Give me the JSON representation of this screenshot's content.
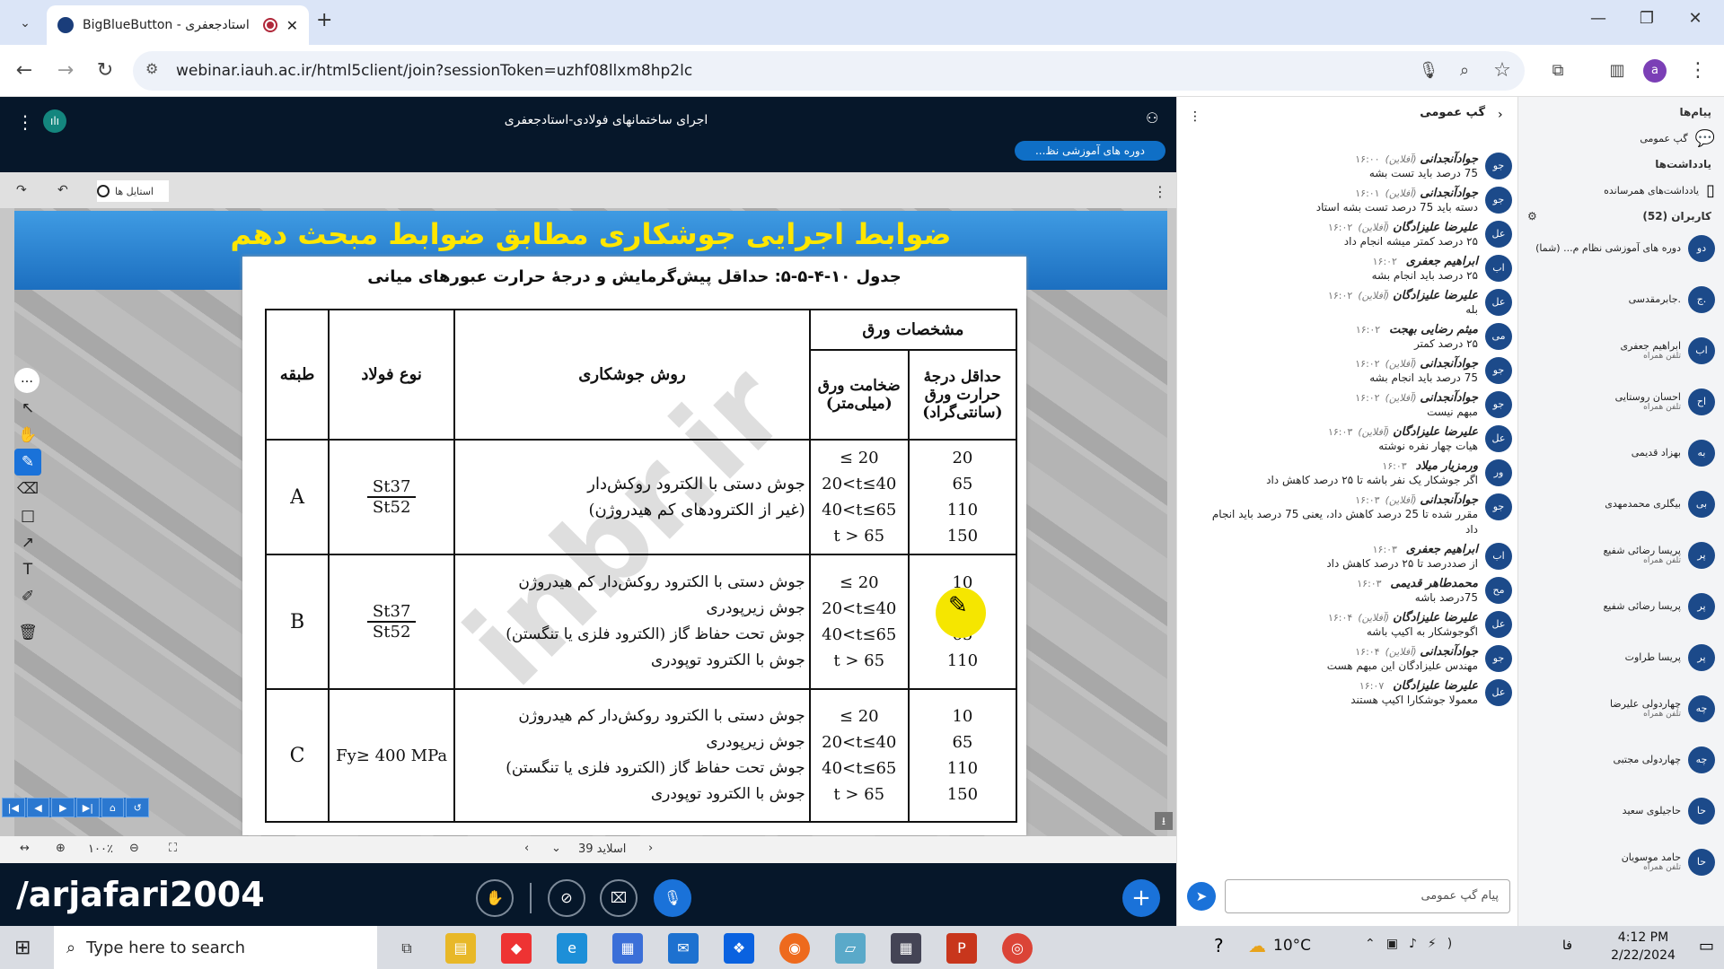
{
  "browser": {
    "tab_title": "BigBlueButton - استادجعفری",
    "url": "webinar.iauh.ac.ir/html5client/join?sessionToken=uzhf08llxm8hp2lc",
    "profile_initial": "a"
  },
  "app": {
    "title": "اجرای ساختمانهای فولادی-استادجعفری",
    "course_badge": "دوره های آموزشی نظ...",
    "styles_label": "استایل ها"
  },
  "slide": {
    "banner": "ضوابط اجرایی جوشکاری مطابق ضوابط مبحث دهم",
    "table_caption": "جدول ۱۰-۴-۵-۵: حداقل پیش‌گرمایش و درجهٔ حرارت عبورهای میانی",
    "headers": {
      "plate_specs": "مشخصات ورق",
      "min_temp": "حداقل درجهٔ حرارت ورق (سانتی‌گراد)",
      "thickness": "ضخامت ورق (میلی‌متر)",
      "method": "روش جوشکاری",
      "steel": "نوع فولاد",
      "class": "طبقه"
    },
    "rows": [
      {
        "class": "A",
        "steel_top": "St37",
        "steel_bottom": "St52",
        "method": [
          "جوش دستی با الکترود روکش‌دار",
          "(غیر از الکترودهای کم هیدروژن)"
        ],
        "thickness": [
          "≤ 20",
          "20<t≤40",
          "40<t≤65",
          "t > 65"
        ],
        "temp": [
          "20",
          "65",
          "110",
          "150"
        ]
      },
      {
        "class": "B",
        "steel_top": "St37",
        "steel_bottom": "St52",
        "method": [
          "جوش دستی با الکترود روکش‌دار کم هیدروژن",
          "جوش زیرپودری",
          "جوش تحت حفاظ گاز (الکترود فلزی یا تنگستن)",
          "جوش با الکترود توپودری"
        ],
        "thickness": [
          "≤ 20",
          "20<t≤40",
          "40<t≤65",
          "t > 65"
        ],
        "temp": [
          "10",
          "20",
          "65",
          "110"
        ]
      },
      {
        "class": "C",
        "steel_top": "Fy≥ 400 MPa",
        "steel_bottom": "",
        "method": [
          "جوش دستی با الکترود روکش‌دار کم هیدروژن",
          "جوش زیرپودری",
          "جوش تحت حفاظ گاز (الکترود فلزی یا تنگستن)",
          "جوش با الکترود توپودری"
        ],
        "thickness": [
          "≤ 20",
          "20<t≤40",
          "40<t≤65",
          "t > 65"
        ],
        "temp": [
          "10",
          "65",
          "110",
          "150"
        ]
      }
    ],
    "slide_label": "اسلاید 39",
    "zoom": "۱۰۰٪"
  },
  "watermark": "/arjafari2004",
  "slide_watermark": "inbr.ir",
  "chat": {
    "title": "گپ عمومی",
    "input_placeholder": "پیام گپ عمومی",
    "messages": [
      {
        "av": "جو",
        "name": "جوادآنجدانی",
        "status": "(آفلاین)",
        "time": "۱۶:۰۰",
        "text": "75 درصد باید تست بشه"
      },
      {
        "av": "جو",
        "name": "جوادآنجدانی",
        "status": "(آفلاین)",
        "time": "۱۶:۰۱",
        "text": "دسته باید 75 درصد تست بشه استاد"
      },
      {
        "av": "عل",
        "name": "علیرضا علیزادگان",
        "status": "(آفلاین)",
        "time": "۱۶:۰۲",
        "text": "۲۵ درصد کمتر میشه انجام داد"
      },
      {
        "av": "اب",
        "name": "ابراهیم جعفری",
        "status": "",
        "time": "۱۶:۰۲",
        "text": "۲۵ درصد باید انجام بشه"
      },
      {
        "av": "عل",
        "name": "علیرضا علیزادگان",
        "status": "(آفلاین)",
        "time": "۱۶:۰۲",
        "text": "بله"
      },
      {
        "av": "می",
        "name": "میثم رضایی بهجت",
        "status": "",
        "time": "۱۶:۰۲",
        "text": "۲۵ درصد کمتر"
      },
      {
        "av": "جو",
        "name": "جوادآنجدانی",
        "status": "(آفلاین)",
        "time": "۱۶:۰۲",
        "text": "75 درصد باید انجام بشه"
      },
      {
        "av": "جو",
        "name": "جوادآنجدانی",
        "status": "(آفلاین)",
        "time": "۱۶:۰۲",
        "text": "مبهم نیست"
      },
      {
        "av": "عل",
        "name": "علیرضا علیزادگان",
        "status": "(آفلاین)",
        "time": "۱۶:۰۳",
        "text": "هیات چهار نفره نوشته"
      },
      {
        "av": "ور",
        "name": "ورمزیار میلاد",
        "status": "",
        "time": "۱۶:۰۳",
        "text": "اگر جوشکار یک نفر باشه تا ۲۵ درصد کاهش داد"
      },
      {
        "av": "جو",
        "name": "جوادآنجدانی",
        "status": "(آفلاین)",
        "time": "۱۶:۰۳",
        "text": "مقرر شده تا 25 درصد کاهش داد، یعنی 75 درصد باید انجام داد"
      },
      {
        "av": "اب",
        "name": "ابراهیم جعفری",
        "status": "",
        "time": "۱۶:۰۳",
        "text": "از صددرصد تا ۲۵ درصد کاهش داد"
      },
      {
        "av": "مح",
        "name": "محمدطاهر قدیمی",
        "status": "",
        "time": "۱۶:۰۳",
        "text": "75درصد باشه"
      },
      {
        "av": "عل",
        "name": "علیرضا علیزادگان",
        "status": "(آفلاین)",
        "time": "۱۶:۰۴",
        "text": "اگوجوشکار به اکیپ باشه"
      },
      {
        "av": "جو",
        "name": "جوادآنجدانی",
        "status": "(آفلاین)",
        "time": "۱۶:۰۴",
        "text": "مهندس علیزادگان این مبهم هست"
      },
      {
        "av": "عل",
        "name": "علیرضا علیزادگان",
        "status": "",
        "time": "۱۶:۰۷",
        "text": "معمولا جوشکارا اکیپ هستند"
      }
    ]
  },
  "sidebar": {
    "messages_title": "پیام‌ها",
    "public_chat": "گپ عمومی",
    "notes_title": "یادداشت‌ها",
    "shared_notes": "یادداشت‌های همرسانده",
    "users_title": "کاربران (52)",
    "users": [
      {
        "av": "دو",
        "name": "دوره های آموزشی نظام م... (شما)",
        "sub": ""
      },
      {
        "av": "ج.",
        "name": ".جابرمقدسی",
        "sub": ""
      },
      {
        "av": "اب",
        "name": "ابراهیم جعفری",
        "sub": "تلفن همراه"
      },
      {
        "av": "اح",
        "name": "احسان روستایی",
        "sub": "تلفن همراه"
      },
      {
        "av": "به",
        "name": "بهزاد قدیمی",
        "sub": ""
      },
      {
        "av": "بی",
        "name": "بیگلری محمدمهدی",
        "sub": ""
      },
      {
        "av": "پر",
        "name": "پریسا رضائی شفیع",
        "sub": "تلفن همراه"
      },
      {
        "av": "پر",
        "name": "پریسا رضائی شفیع",
        "sub": ""
      },
      {
        "av": "پر",
        "name": "پریسا طراوت",
        "sub": ""
      },
      {
        "av": "چه",
        "name": "چهاردولی علیرضا",
        "sub": "تلفن همراه"
      },
      {
        "av": "چه",
        "name": "چهاردولی مجتبی",
        "sub": ""
      },
      {
        "av": "حا",
        "name": "حاجیلوی سعید",
        "sub": ""
      },
      {
        "av": "حا",
        "name": "حامد موسویان",
        "sub": "تلفن همراه"
      }
    ]
  },
  "taskbar": {
    "search_placeholder": "Type here to search",
    "weather": "10°C",
    "time": "4:12 PM",
    "date": "2/22/2024",
    "lang": "فا"
  }
}
